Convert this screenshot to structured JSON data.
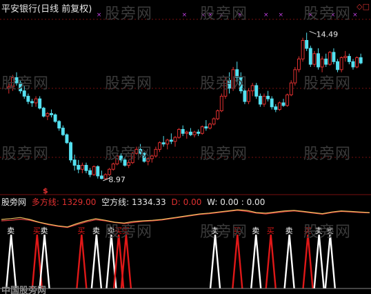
{
  "header": {
    "stock_name": "平安银行",
    "period": "(日线 前复权)"
  },
  "watermark": "股旁网",
  "corner_symbol": "◇□",
  "indicator": {
    "site": "股旁网",
    "long_label": "多方线:",
    "long_value": "1329.00",
    "short_label": "空方线:",
    "short_value": "1334.33",
    "d_label": "D:",
    "d_value": "0.00",
    "w_label": "W:",
    "w_value": "0.00 : 0.00",
    "bottom_text": "中国股旁网"
  },
  "signal_labels": {
    "sell": "卖",
    "buy": "买"
  },
  "colors": {
    "background": "#000000",
    "up_candle": "#e03030",
    "down_candle": "#54e0f0",
    "long_line": "#f0c060",
    "short_line": "#e04040",
    "sell_spike": "#ffffff",
    "buy_spike": "#e01818",
    "grid": "#7a1010",
    "marker": "#c040e0"
  },
  "chart_data": {
    "type": "candlestick",
    "title": "平安银行(日线 前复权)",
    "annotations": [
      {
        "text": "14.49",
        "kind": "high"
      },
      {
        "text": "8.97",
        "kind": "low"
      },
      {
        "text": "$",
        "kind": "marker"
      }
    ],
    "price_ylim": [
      8.5,
      15.2
    ],
    "grid": true,
    "candles": [
      [
        12.4,
        12.6,
        12.2,
        12.45
      ],
      [
        12.45,
        12.9,
        12.3,
        12.8
      ],
      [
        12.8,
        13.0,
        12.5,
        12.6
      ],
      [
        12.6,
        12.7,
        12.2,
        12.3
      ],
      [
        12.3,
        12.5,
        12.0,
        12.1
      ],
      [
        12.1,
        12.2,
        11.8,
        11.9
      ],
      [
        11.9,
        12.0,
        11.7,
        11.85
      ],
      [
        11.85,
        12.1,
        11.7,
        12.0
      ],
      [
        12.0,
        12.1,
        11.6,
        11.65
      ],
      [
        11.65,
        11.7,
        11.3,
        11.35
      ],
      [
        11.35,
        11.5,
        11.2,
        11.45
      ],
      [
        11.45,
        11.6,
        11.3,
        11.4
      ],
      [
        11.4,
        11.45,
        11.1,
        11.15
      ],
      [
        11.15,
        11.2,
        10.8,
        10.9
      ],
      [
        10.9,
        11.0,
        10.6,
        10.65
      ],
      [
        10.65,
        10.7,
        10.3,
        10.35
      ],
      [
        10.35,
        10.4,
        9.6,
        9.7
      ],
      [
        9.7,
        9.9,
        9.3,
        9.5
      ],
      [
        9.5,
        9.7,
        9.2,
        9.35
      ],
      [
        9.35,
        9.6,
        9.2,
        9.5
      ],
      [
        9.5,
        9.6,
        9.2,
        9.3
      ],
      [
        9.3,
        9.4,
        9.05,
        9.15
      ],
      [
        9.15,
        9.5,
        9.1,
        9.45
      ],
      [
        9.45,
        9.5,
        9.0,
        9.1
      ],
      [
        9.1,
        9.3,
        8.97,
        9.0
      ],
      [
        9.0,
        9.2,
        8.97,
        9.15
      ],
      [
        9.15,
        9.4,
        9.1,
        9.35
      ],
      [
        9.35,
        9.6,
        9.3,
        9.55
      ],
      [
        9.55,
        9.9,
        9.5,
        9.85
      ],
      [
        9.85,
        9.95,
        9.6,
        9.7
      ],
      [
        9.7,
        9.8,
        9.45,
        9.5
      ],
      [
        9.5,
        9.7,
        9.4,
        9.6
      ],
      [
        9.6,
        10.0,
        9.55,
        9.95
      ],
      [
        9.95,
        10.2,
        9.9,
        10.1
      ],
      [
        10.1,
        10.3,
        9.9,
        9.95
      ],
      [
        9.95,
        10.0,
        9.6,
        9.65
      ],
      [
        9.65,
        9.8,
        9.5,
        9.75
      ],
      [
        9.75,
        9.9,
        9.6,
        9.85
      ],
      [
        9.85,
        10.2,
        9.8,
        10.1
      ],
      [
        10.1,
        10.4,
        10.0,
        10.35
      ],
      [
        10.35,
        10.6,
        10.2,
        10.3
      ],
      [
        10.3,
        10.5,
        10.1,
        10.45
      ],
      [
        10.45,
        10.7,
        10.3,
        10.4
      ],
      [
        10.4,
        10.6,
        10.2,
        10.55
      ],
      [
        10.55,
        10.9,
        10.5,
        10.85
      ],
      [
        10.85,
        11.0,
        10.6,
        10.7
      ],
      [
        10.7,
        10.8,
        10.5,
        10.75
      ],
      [
        10.75,
        10.9,
        10.6,
        10.65
      ],
      [
        10.65,
        10.8,
        10.55,
        10.75
      ],
      [
        10.75,
        10.85,
        10.6,
        10.7
      ],
      [
        10.7,
        11.0,
        10.65,
        10.95
      ],
      [
        10.95,
        11.2,
        10.8,
        10.9
      ],
      [
        10.9,
        11.1,
        10.85,
        11.05
      ],
      [
        11.05,
        11.3,
        11.0,
        11.25
      ],
      [
        11.25,
        11.6,
        11.2,
        11.55
      ],
      [
        11.55,
        12.2,
        11.5,
        12.1
      ],
      [
        12.1,
        12.8,
        12.0,
        12.7
      ],
      [
        12.7,
        13.0,
        12.2,
        12.4
      ],
      [
        12.4,
        13.2,
        12.3,
        13.1
      ],
      [
        13.1,
        13.4,
        12.6,
        12.8
      ],
      [
        12.8,
        13.0,
        12.2,
        12.3
      ],
      [
        12.3,
        12.5,
        11.8,
        11.9
      ],
      [
        11.9,
        12.4,
        11.8,
        12.3
      ],
      [
        12.3,
        12.6,
        12.1,
        12.5
      ],
      [
        12.5,
        12.6,
        12.0,
        12.1
      ],
      [
        12.1,
        12.2,
        11.7,
        11.8
      ],
      [
        11.8,
        12.2,
        11.7,
        12.1
      ],
      [
        12.1,
        12.3,
        11.9,
        12.0
      ],
      [
        12.0,
        12.1,
        11.6,
        11.7
      ],
      [
        11.7,
        11.8,
        11.5,
        11.6
      ],
      [
        11.6,
        11.9,
        11.55,
        11.85
      ],
      [
        11.85,
        12.0,
        11.7,
        11.75
      ],
      [
        11.75,
        12.2,
        11.7,
        12.15
      ],
      [
        12.15,
        12.7,
        12.1,
        12.6
      ],
      [
        12.6,
        13.2,
        12.5,
        13.1
      ],
      [
        13.1,
        13.6,
        13.0,
        13.5
      ],
      [
        13.5,
        14.3,
        13.4,
        14.2
      ],
      [
        14.2,
        14.49,
        13.8,
        13.9
      ],
      [
        13.9,
        14.0,
        13.2,
        13.3
      ],
      [
        13.3,
        13.8,
        13.2,
        13.7
      ],
      [
        13.7,
        13.9,
        13.1,
        13.2
      ],
      [
        13.2,
        13.6,
        13.0,
        13.5
      ],
      [
        13.5,
        13.7,
        13.2,
        13.3
      ],
      [
        13.3,
        13.8,
        13.25,
        13.75
      ],
      [
        13.75,
        13.9,
        13.3,
        13.4
      ],
      [
        13.4,
        13.5,
        13.0,
        13.1
      ],
      [
        13.1,
        13.6,
        13.0,
        13.55
      ],
      [
        13.55,
        13.8,
        13.4,
        13.6
      ],
      [
        13.6,
        13.7,
        13.3,
        13.4
      ],
      [
        13.4,
        13.5,
        13.1,
        13.2
      ],
      [
        13.2,
        13.6,
        13.15,
        13.55
      ],
      [
        13.55,
        13.7,
        13.3,
        13.35
      ]
    ],
    "long_line": [
      0.55,
      0.58,
      0.62,
      0.55,
      0.45,
      0.38,
      0.32,
      0.28,
      0.4,
      0.5,
      0.58,
      0.52,
      0.45,
      0.42,
      0.48,
      0.5,
      0.52,
      0.55,
      0.6,
      0.65,
      0.7,
      0.75,
      0.78,
      0.82,
      0.86,
      0.9,
      0.88,
      0.8,
      0.78,
      0.82,
      0.86,
      0.88,
      0.84,
      0.8,
      0.76,
      0.82,
      0.86,
      0.84,
      0.82,
      0.8
    ],
    "short_line": [
      0.5,
      0.52,
      0.56,
      0.52,
      0.44,
      0.36,
      0.3,
      0.26,
      0.36,
      0.46,
      0.54,
      0.5,
      0.44,
      0.4,
      0.44,
      0.48,
      0.5,
      0.53,
      0.58,
      0.63,
      0.68,
      0.73,
      0.76,
      0.8,
      0.84,
      0.88,
      0.84,
      0.78,
      0.75,
      0.79,
      0.83,
      0.86,
      0.82,
      0.78,
      0.74,
      0.8,
      0.84,
      0.82,
      0.8,
      0.79
    ],
    "signals": [
      {
        "type": "sell",
        "pos": 0.03
      },
      {
        "type": "buy",
        "pos": 0.1
      },
      {
        "type": "sell",
        "pos": 0.12
      },
      {
        "type": "buy",
        "pos": 0.22
      },
      {
        "type": "sell",
        "pos": 0.26
      },
      {
        "type": "sell",
        "pos": 0.3
      },
      {
        "type": "buy",
        "pos": 0.32
      },
      {
        "type": "buy",
        "pos": 0.34
      },
      {
        "type": "sell",
        "pos": 0.58
      },
      {
        "type": "buy",
        "pos": 0.64
      },
      {
        "type": "sell",
        "pos": 0.69
      },
      {
        "type": "buy",
        "pos": 0.73
      },
      {
        "type": "sell",
        "pos": 0.78
      },
      {
        "type": "buy",
        "pos": 0.83
      },
      {
        "type": "sell",
        "pos": 0.86
      },
      {
        "type": "sell",
        "pos": 0.89
      }
    ],
    "top_markers": [
      0.26,
      0.49,
      0.54,
      0.56,
      0.59,
      0.64,
      0.71,
      0.75,
      0.83,
      0.89,
      0.95
    ]
  }
}
